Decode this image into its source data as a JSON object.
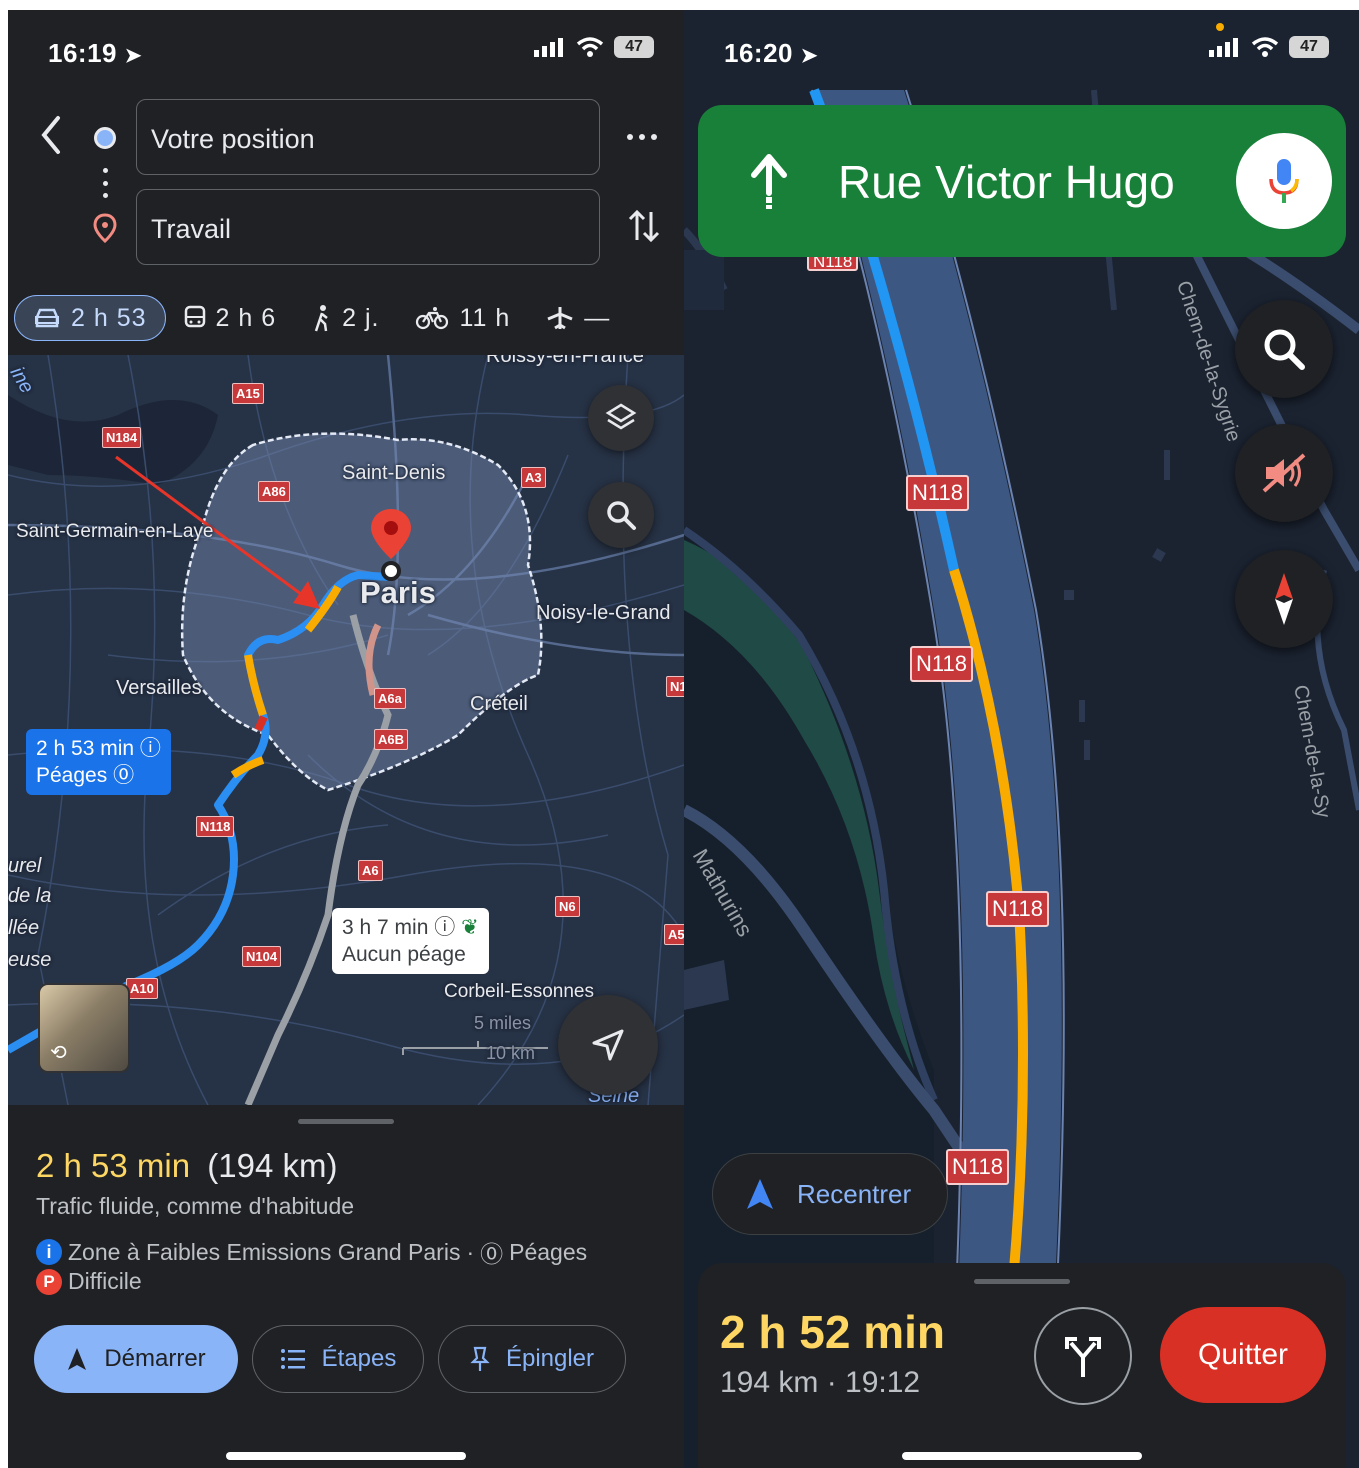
{
  "left": {
    "status": {
      "time": "16:19",
      "battery": "47"
    },
    "origin": "Votre position",
    "destination": "Travail",
    "modes": [
      {
        "icon": "car-icon",
        "label": "2 h 53"
      },
      {
        "icon": "transit-icon",
        "label": "2 h 6"
      },
      {
        "icon": "walk-icon",
        "label": "2 j."
      },
      {
        "icon": "bike-icon",
        "label": "11 h"
      },
      {
        "icon": "flight-icon",
        "label": "—"
      }
    ],
    "map": {
      "places": [
        "Roissy-en-France",
        "Saint-Denis",
        "Saint-Germain-en-Laye",
        "Paris",
        "Noisy-le-Grand",
        "Versailles",
        "Créteil",
        "Corbeil-Essonnes",
        "Seine"
      ],
      "roads": [
        "A15",
        "N184",
        "A86",
        "A3",
        "A6a",
        "A6B",
        "N118",
        "A6",
        "N6",
        "N104",
        "A10",
        "A5",
        "N1"
      ],
      "fragments": [
        "urel",
        "de la",
        "llée",
        "euse",
        "ine"
      ],
      "scale": [
        "5 miles",
        "10 km"
      ],
      "route_main": {
        "time": "2 h 53 min",
        "note": "Péages"
      },
      "route_alt": {
        "time": "3 h 7 min",
        "note": "Aucun péage"
      }
    },
    "sheet": {
      "duration": "2 h 53 min",
      "distance": "(194 km)",
      "traffic": "Trafic fluide, comme d'habitude",
      "info1": "Zone à Faibles Emissions Grand Paris",
      "sep": "·",
      "info2": "Péages",
      "parking_badge": "P",
      "parking": "Difficile",
      "buttons": {
        "start": "Démarrer",
        "steps": "Étapes",
        "pin": "Épingler"
      }
    },
    "colors": {
      "accent": "#8ab4f8",
      "duration": "#fdd663",
      "route": "#4285f4",
      "traffic": "#f9ab00"
    }
  },
  "right": {
    "status": {
      "time": "16:20",
      "battery": "47"
    },
    "instruction": "Rue Victor Hugo",
    "map": {
      "roads": [
        "N118",
        "N118",
        "N118",
        "N118",
        "N118"
      ],
      "streets": [
        "Chem-de-la-Sygrie",
        "Chem-de-la-Sy",
        "Mathurins"
      ]
    },
    "recenter": "Recentrer",
    "eta": {
      "duration": "2 h 52 min",
      "detail": "194 km · 19:12"
    },
    "quit": "Quitter",
    "colors": {
      "banner": "#188038",
      "quit": "#d93025"
    }
  }
}
